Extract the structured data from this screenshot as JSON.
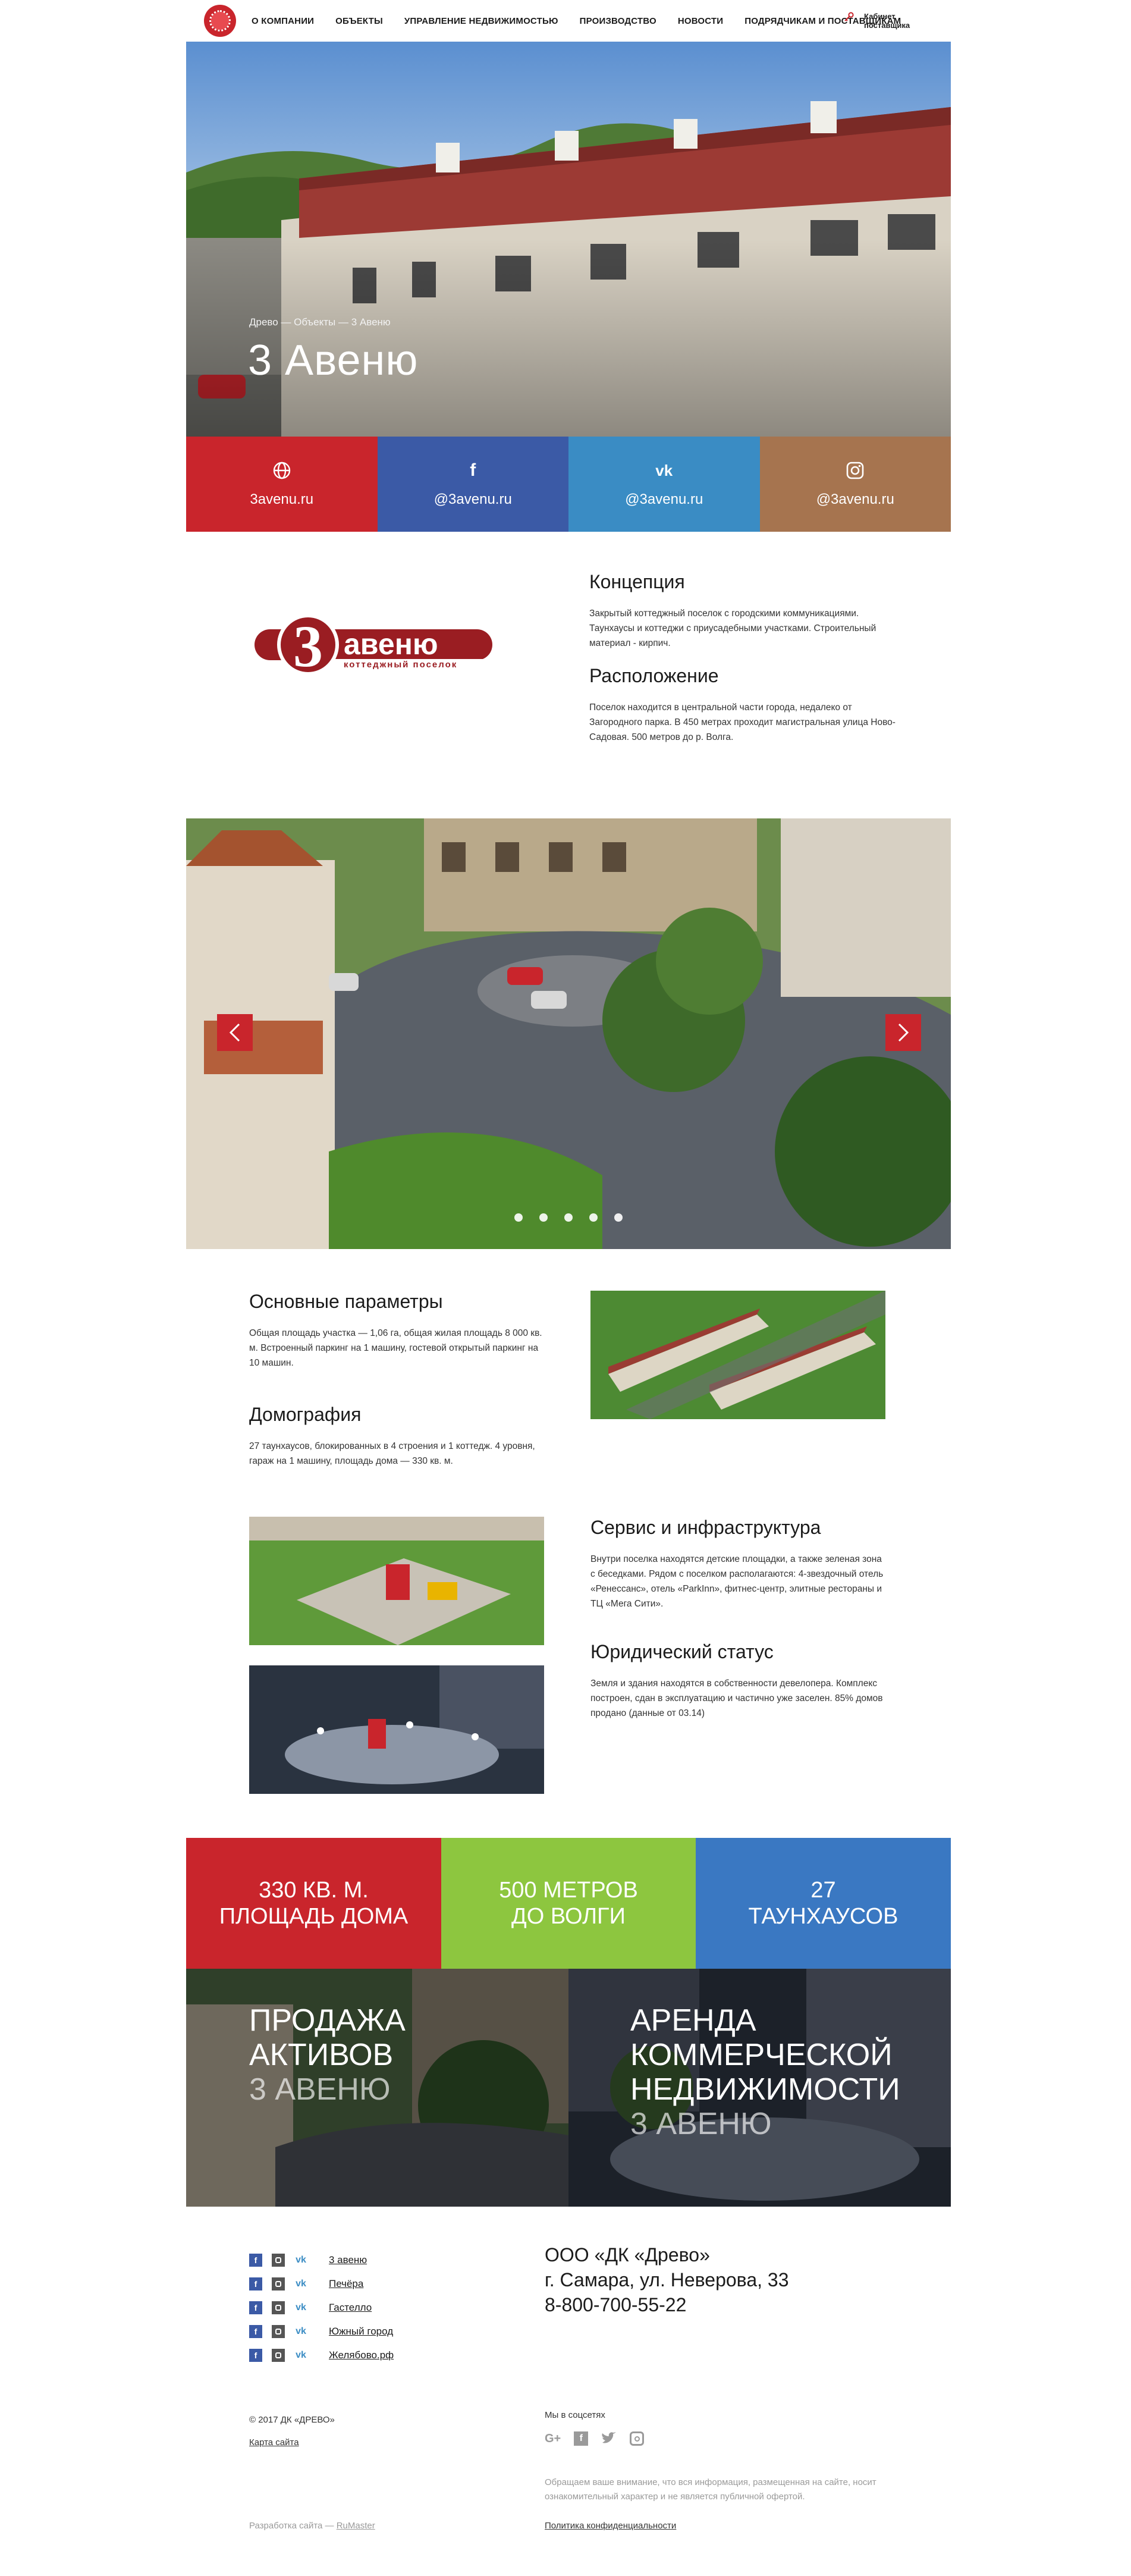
{
  "nav": {
    "items": [
      "О компании",
      "Объекты",
      "Управление недвижимостью",
      "Производство",
      "Новости",
      "Подрядчикам и поставщикам"
    ],
    "cabinet": "Кабинет поставщика"
  },
  "hero": {
    "breadcrumb": "Древо — Объекты — 3 Авеню",
    "title": "3 Авеню"
  },
  "social_tiles": [
    {
      "icon": "globe-icon",
      "label": "3avenu.ru",
      "color": "#c9252c"
    },
    {
      "icon": "facebook-icon",
      "label": "@3avenu.ru",
      "color": "#3b5aa6"
    },
    {
      "icon": "vk-icon",
      "label": "@3avenu.ru",
      "color": "#3a8cc4"
    },
    {
      "icon": "instagram-icon",
      "label": "@3avenu.ru",
      "color": "#a6744f"
    }
  ],
  "brand": {
    "digit": "3",
    "name": "авеню",
    "tagline": "коттеджный поселок"
  },
  "concept": {
    "title": "Концепция",
    "text": "Закрытый коттеджный поселок с городскими коммуникациями. Таунхаусы и коттеджи с приусадебными участками. Строительный материал - кирпич.",
    "location_title": "Расположение",
    "location_text": "Поселок находится в центральной части города, недалеко от Загородного парка. В 450 метрах проходит магистральная улица Ново-Садовая. 500 метров до р. Волга."
  },
  "slider": {
    "slides_count": 5
  },
  "params": {
    "title": "Основные параметры",
    "text": "Общая площадь участка — 1,06 га, общая жилая площадь 8 000 кв. м. Встроенный паркинг на 1 машину, гостевой открытый паркинг на 10 машин.",
    "demo_title": "Домография",
    "demo_text": "27 таунхаусов, блокированных в 4 строения и 1 коттедж. 4 уровня, гараж на 1 машину, площадь дома — 330 кв. м."
  },
  "service": {
    "title": "Сервис и инфраструктура",
    "text": "Внутри поселка находятся детские площадки, а также зеленая зона с беседками. Рядом с поселком располагаются: 4-звездочный отель «Ренессанс», отель «ParkInn», фитнес-центр, элитные рестораны и ТЦ «Мега Сити».",
    "legal_title": "Юридический статус",
    "legal_text": "Земля и здания находятся в собственности девелопера. Комплекс построен, сдан в эксплуатацию и частично уже заселен. 85% домов продано (данные от 03.14)"
  },
  "stats": [
    {
      "line1": "330 кв. м.",
      "line2": "площадь дома",
      "color": "#c9252c"
    },
    {
      "line1": "500 метров",
      "line2": "до Волги",
      "color": "#8dc63f"
    },
    {
      "line1": "27",
      "line2": "таунхаусов",
      "color": "#3a78c2"
    }
  ],
  "cards": [
    {
      "line1": "Продажа",
      "line2": "активов",
      "sub": "3 Авеню"
    },
    {
      "line1": "Аренда",
      "line2": "коммерческой",
      "line3": "недвижимости",
      "sub": "3 Авеню"
    }
  ],
  "footer": {
    "projects": [
      "3 авеню",
      "Печёра",
      "Гастелло",
      "Южный город",
      "Желябово.рф"
    ],
    "company_name": "ООО «ДК «Древо»",
    "address": "г. Самара, ул. Неверова, 33",
    "phone": "8-800-700-55-22",
    "copyright": "© 2017 ДК «ДРЕВО»",
    "sitemap": "Карта сайта",
    "social_title": "Мы в соцсетях",
    "disclaimer": "Обращаем ваше внимание, что вся информация, размещенная на сайте, носит ознакомительный характер и не является публичной офертой.",
    "dev_prefix": "Разработка сайта — ",
    "dev_link": "RuMaster",
    "privacy": "Политика конфиденциальности"
  }
}
